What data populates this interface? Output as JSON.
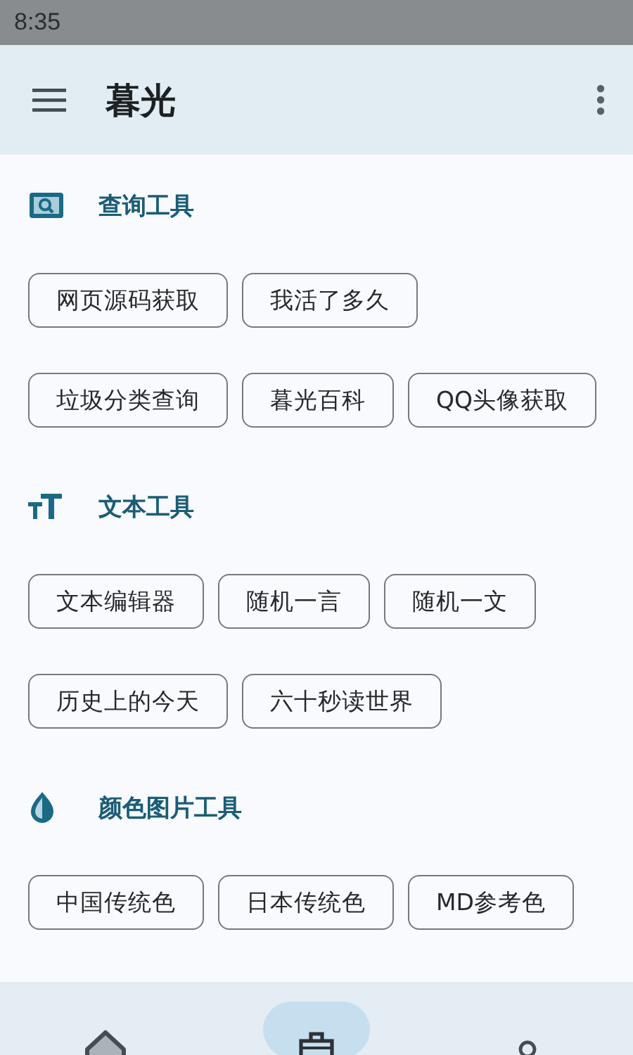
{
  "status_bar": {
    "time": "8:35"
  },
  "app_bar": {
    "title": "暮光"
  },
  "sections": [
    {
      "kind": "search",
      "title": "查询工具",
      "items": [
        "网页源码获取",
        "我活了多久",
        "垃圾分类查询",
        "暮光百科",
        "QQ头像获取"
      ]
    },
    {
      "kind": "text",
      "title": "文本工具",
      "items": [
        "文本编辑器",
        "随机一言",
        "随机一文",
        "历史上的今天",
        "六十秒读世界"
      ]
    },
    {
      "kind": "color",
      "title": "颜色图片工具",
      "items": [
        "中国传统色",
        "日本传统色",
        "MD参考色"
      ]
    }
  ],
  "bottom_nav": [
    {
      "kind": "home",
      "selected": false
    },
    {
      "kind": "toolbox",
      "selected": true
    },
    {
      "kind": "person",
      "selected": false
    }
  ]
}
